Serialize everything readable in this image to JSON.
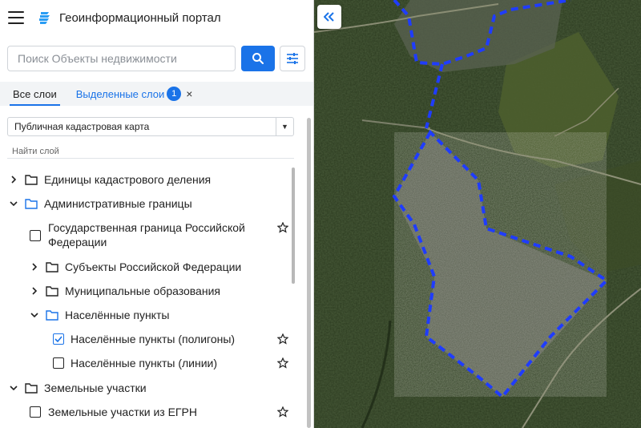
{
  "header": {
    "title": "Геоинформационный портал"
  },
  "search": {
    "placeholder": "Поиск Объекты недвижимости"
  },
  "tabs": {
    "all_layers": "Все слои",
    "selected_layers": "Выделенные слои",
    "selected_count": "1",
    "close_symbol": "×"
  },
  "basemap": {
    "selected": "Публичная кадастровая карта"
  },
  "layer_search": {
    "placeholder": "Найти слой"
  },
  "tree": {
    "items": [
      {
        "label": "Единицы кадастрового деления"
      },
      {
        "label": "Административные границы"
      },
      {
        "label": "Государственная граница Российской Федерации"
      },
      {
        "label": "Субъекты Российской Федерации"
      },
      {
        "label": "Муниципальные образования"
      },
      {
        "label": "Населённые пункты"
      },
      {
        "label": "Населённые пункты (полигоны)",
        "checked": true
      },
      {
        "label": "Населённые пункты (линии)",
        "checked": false
      },
      {
        "label": "Земельные участки"
      },
      {
        "label": "Земельные участки из ЕГРН",
        "checked": false
      }
    ]
  },
  "colors": {
    "accent": "#1a73e8",
    "boundary": "#1f3cff",
    "forest": "#2b3a1f"
  }
}
